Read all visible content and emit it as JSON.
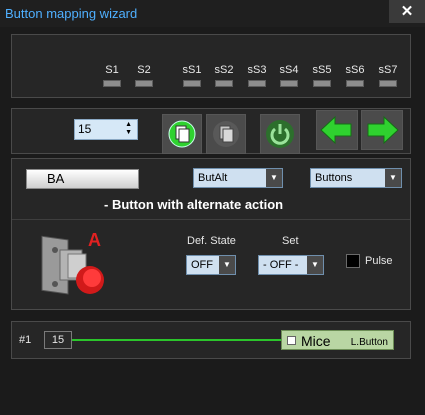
{
  "window": {
    "title": "Button mapping wizard",
    "close_label": "✕"
  },
  "slots": [
    "S1",
    "S2",
    "sS1",
    "sS2",
    "sS3",
    "sS4",
    "sS5",
    "sS6",
    "sS7"
  ],
  "toolbar": {
    "spin_value": "15"
  },
  "config": {
    "button_label": "BA",
    "type_dropdown": "ButAlt",
    "category_dropdown": "Buttons",
    "description": "- Button with alternate action"
  },
  "state": {
    "badge": "A",
    "def_state_label": "Def. State",
    "def_state_value": "OFF",
    "set_label": "Set",
    "set_value": "- OFF -",
    "pulse_label": "Pulse"
  },
  "mapping": {
    "index": "#1",
    "value": "15",
    "device": "Mice",
    "button": "L.Button"
  },
  "colors": {
    "accent": "#4fb0ff",
    "line": "#2bc52b",
    "green": "#2fd12f"
  }
}
